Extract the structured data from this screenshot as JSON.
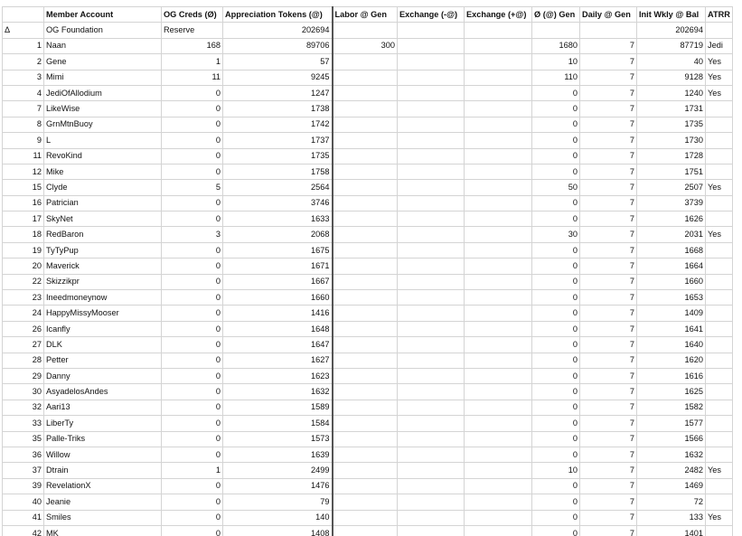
{
  "columns": [
    "",
    "Member Account",
    "OG Creds (Ø)",
    "Appreciation Tokens (@)",
    "Labor @ Gen",
    "Exchange (-@)",
    "Exchange (+@)",
    "Ø (@) Gen",
    "Daily @ Gen",
    "Init Wkly @ Bal",
    "ATRR"
  ],
  "foundation": {
    "marker": "Δ",
    "account": "OG Foundation",
    "creds": "Reserve",
    "tokens": "202694",
    "init_bal": "202694"
  },
  "rows": [
    {
      "id": "1",
      "name": "Naan",
      "creds": "168",
      "tokens": "89706",
      "labor": "300",
      "gen": "1680",
      "daily": "7",
      "bal": "87719",
      "atrr": "Jedi"
    },
    {
      "id": "2",
      "name": "Gene",
      "creds": "1",
      "tokens": "57",
      "labor": "",
      "gen": "10",
      "daily": "7",
      "bal": "40",
      "atrr": "Yes"
    },
    {
      "id": "3",
      "name": "Mimi",
      "creds": "11",
      "tokens": "9245",
      "labor": "",
      "gen": "110",
      "daily": "7",
      "bal": "9128",
      "atrr": "Yes"
    },
    {
      "id": "4",
      "name": "JediOfAllodium",
      "creds": "0",
      "tokens": "1247",
      "labor": "",
      "gen": "0",
      "daily": "7",
      "bal": "1240",
      "atrr": "Yes"
    },
    {
      "id": "7",
      "name": "LikeWise",
      "creds": "0",
      "tokens": "1738",
      "labor": "",
      "gen": "0",
      "daily": "7",
      "bal": "1731",
      "atrr": ""
    },
    {
      "id": "8",
      "name": "GrnMtnBuoy",
      "creds": "0",
      "tokens": "1742",
      "labor": "",
      "gen": "0",
      "daily": "7",
      "bal": "1735",
      "atrr": ""
    },
    {
      "id": "9",
      "name": "L",
      "creds": "0",
      "tokens": "1737",
      "labor": "",
      "gen": "0",
      "daily": "7",
      "bal": "1730",
      "atrr": ""
    },
    {
      "id": "11",
      "name": "RevoKind",
      "creds": "0",
      "tokens": "1735",
      "labor": "",
      "gen": "0",
      "daily": "7",
      "bal": "1728",
      "atrr": ""
    },
    {
      "id": "12",
      "name": "Mike",
      "creds": "0",
      "tokens": "1758",
      "labor": "",
      "gen": "0",
      "daily": "7",
      "bal": "1751",
      "atrr": ""
    },
    {
      "id": "15",
      "name": "Clyde",
      "creds": "5",
      "tokens": "2564",
      "labor": "",
      "gen": "50",
      "daily": "7",
      "bal": "2507",
      "atrr": "Yes"
    },
    {
      "id": "16",
      "name": "Patrician",
      "creds": "0",
      "tokens": "3746",
      "labor": "",
      "gen": "0",
      "daily": "7",
      "bal": "3739",
      "atrr": ""
    },
    {
      "id": "17",
      "name": "SkyNet",
      "creds": "0",
      "tokens": "1633",
      "labor": "",
      "gen": "0",
      "daily": "7",
      "bal": "1626",
      "atrr": ""
    },
    {
      "id": "18",
      "name": "RedBaron",
      "creds": "3",
      "tokens": "2068",
      "labor": "",
      "gen": "30",
      "daily": "7",
      "bal": "2031",
      "atrr": "Yes"
    },
    {
      "id": "19",
      "name": "TyTyPup",
      "creds": "0",
      "tokens": "1675",
      "labor": "",
      "gen": "0",
      "daily": "7",
      "bal": "1668",
      "atrr": ""
    },
    {
      "id": "20",
      "name": "Maverick",
      "creds": "0",
      "tokens": "1671",
      "labor": "",
      "gen": "0",
      "daily": "7",
      "bal": "1664",
      "atrr": ""
    },
    {
      "id": "22",
      "name": "Skizzikpr",
      "creds": "0",
      "tokens": "1667",
      "labor": "",
      "gen": "0",
      "daily": "7",
      "bal": "1660",
      "atrr": ""
    },
    {
      "id": "23",
      "name": "Ineedmoneynow",
      "creds": "0",
      "tokens": "1660",
      "labor": "",
      "gen": "0",
      "daily": "7",
      "bal": "1653",
      "atrr": ""
    },
    {
      "id": "24",
      "name": "HappyMissyMooser",
      "creds": "0",
      "tokens": "1416",
      "labor": "",
      "gen": "0",
      "daily": "7",
      "bal": "1409",
      "atrr": ""
    },
    {
      "id": "26",
      "name": "Icanfly",
      "creds": "0",
      "tokens": "1648",
      "labor": "",
      "gen": "0",
      "daily": "7",
      "bal": "1641",
      "atrr": ""
    },
    {
      "id": "27",
      "name": "DLK",
      "creds": "0",
      "tokens": "1647",
      "labor": "",
      "gen": "0",
      "daily": "7",
      "bal": "1640",
      "atrr": ""
    },
    {
      "id": "28",
      "name": "Petter",
      "creds": "0",
      "tokens": "1627",
      "labor": "",
      "gen": "0",
      "daily": "7",
      "bal": "1620",
      "atrr": ""
    },
    {
      "id": "29",
      "name": "Danny",
      "creds": "0",
      "tokens": "1623",
      "labor": "",
      "gen": "0",
      "daily": "7",
      "bal": "1616",
      "atrr": ""
    },
    {
      "id": "30",
      "name": "AsyadelosAndes",
      "creds": "0",
      "tokens": "1632",
      "labor": "",
      "gen": "0",
      "daily": "7",
      "bal": "1625",
      "atrr": ""
    },
    {
      "id": "32",
      "name": "Aari13",
      "creds": "0",
      "tokens": "1589",
      "labor": "",
      "gen": "0",
      "daily": "7",
      "bal": "1582",
      "atrr": ""
    },
    {
      "id": "33",
      "name": "LiberTy",
      "creds": "0",
      "tokens": "1584",
      "labor": "",
      "gen": "0",
      "daily": "7",
      "bal": "1577",
      "atrr": ""
    },
    {
      "id": "35",
      "name": "Palle-Triks",
      "creds": "0",
      "tokens": "1573",
      "labor": "",
      "gen": "0",
      "daily": "7",
      "bal": "1566",
      "atrr": ""
    },
    {
      "id": "36",
      "name": "Willow",
      "creds": "0",
      "tokens": "1639",
      "labor": "",
      "gen": "0",
      "daily": "7",
      "bal": "1632",
      "atrr": ""
    },
    {
      "id": "37",
      "name": "Dtrain",
      "creds": "1",
      "tokens": "2499",
      "labor": "",
      "gen": "10",
      "daily": "7",
      "bal": "2482",
      "atrr": "Yes"
    },
    {
      "id": "39",
      "name": "RevelationX",
      "creds": "0",
      "tokens": "1476",
      "labor": "",
      "gen": "0",
      "daily": "7",
      "bal": "1469",
      "atrr": ""
    },
    {
      "id": "40",
      "name": "Jeanie",
      "creds": "0",
      "tokens": "79",
      "labor": "",
      "gen": "0",
      "daily": "7",
      "bal": "72",
      "atrr": ""
    },
    {
      "id": "41",
      "name": "Smiles",
      "creds": "0",
      "tokens": "140",
      "labor": "",
      "gen": "0",
      "daily": "7",
      "bal": "133",
      "atrr": "Yes"
    },
    {
      "id": "42",
      "name": "MK",
      "creds": "0",
      "tokens": "1408",
      "labor": "",
      "gen": "0",
      "daily": "7",
      "bal": "1401",
      "atrr": ""
    }
  ]
}
